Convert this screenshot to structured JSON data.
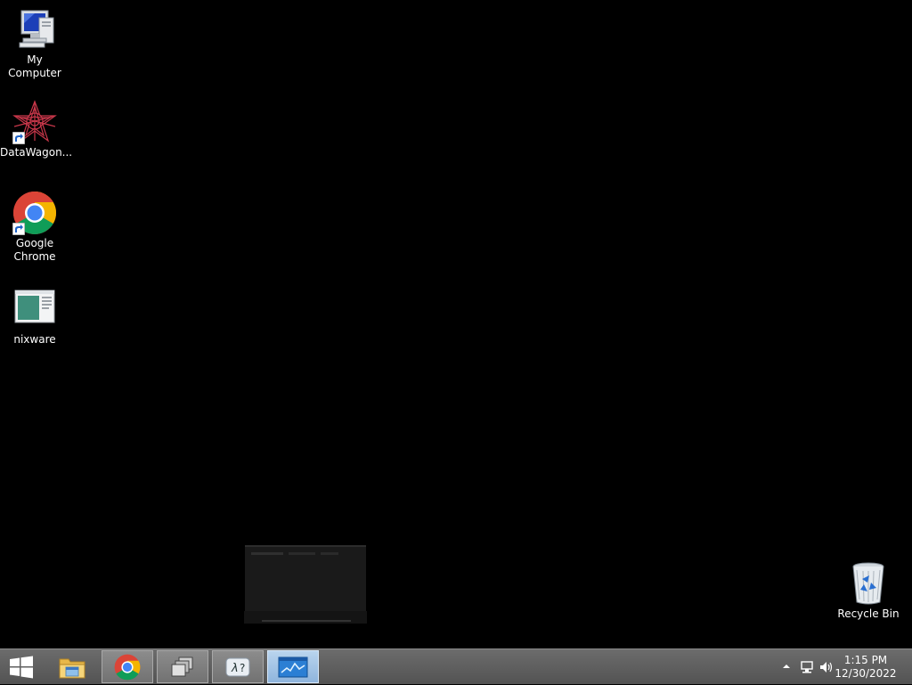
{
  "desktop": {
    "icons": [
      {
        "label": "My Computer",
        "icon": "computer-icon"
      },
      {
        "label": "DataWagon...",
        "icon": "datawagon-icon"
      },
      {
        "label": "Google\nChrome",
        "icon": "chrome-icon"
      },
      {
        "label": "nixware",
        "icon": "nixware-icon"
      },
      {
        "label": "Recycle Bin",
        "icon": "recycle-bin-icon"
      }
    ]
  },
  "taskbar": {
    "buttons": [
      {
        "name": "start-button",
        "icon": "windows-logo-icon"
      },
      {
        "name": "file-explorer",
        "icon": "folder-icon"
      },
      {
        "name": "chrome",
        "icon": "chrome-icon"
      },
      {
        "name": "task-view",
        "icon": "windows-stack-icon"
      },
      {
        "name": "lambda-app",
        "icon": "lambda-icon"
      },
      {
        "name": "monitor-app",
        "icon": "chart-window-icon"
      }
    ],
    "tray": {
      "icons": [
        "show-hidden-icons-arrow",
        "network-icon",
        "volume-icon"
      ],
      "time": "1:15 PM",
      "date": "12/30/2022"
    }
  },
  "colors": {
    "desktop_bg": "#000000",
    "taskbar_bg": "#5f5f5f",
    "focused_button": "#a6c6e8"
  }
}
